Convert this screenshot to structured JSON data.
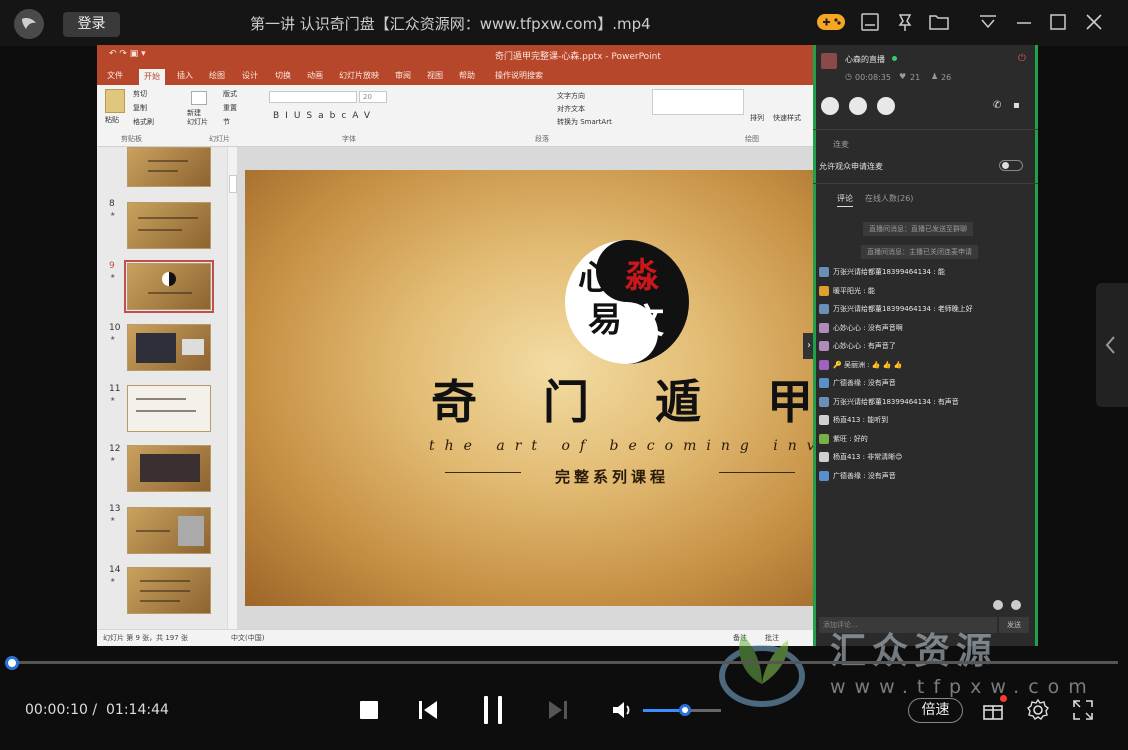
{
  "topbar": {
    "login_label": "登录",
    "title": "第一讲 认识奇门盘【汇众资源网：www.tfpxw.com】.mp4",
    "icons": [
      "game-icon",
      "playlist-icon",
      "pin-icon",
      "folder-icon",
      "menu-icon",
      "minimize-icon",
      "maximize-icon",
      "close-icon"
    ]
  },
  "ppt": {
    "doc_title": "奇门遁甲完整课-心森.pptx - PowerPoint",
    "tabs": [
      "文件",
      "开始",
      "插入",
      "绘图",
      "设计",
      "切换",
      "动画",
      "幻灯片放映",
      "审阅",
      "视图",
      "帮助",
      "操作说明搜索"
    ],
    "active_tab": "开始",
    "ribbon": {
      "paste": "粘贴",
      "cut": "剪切",
      "copy": "复制",
      "format_painter": "格式刷",
      "new_slide": "新建\n幻灯片",
      "layout": "版式",
      "reset": "重置",
      "section": "节",
      "font_size": "20",
      "text_direction": "文字方向",
      "align_text": "对齐文本",
      "smartart": "转换为 SmartArt",
      "arrange": "排列",
      "quick_styles": "快速样式",
      "groups": [
        "剪贴板",
        "幻灯片",
        "字体",
        "段落",
        "绘图"
      ]
    },
    "thumbs": [
      {
        "num": ""
      },
      {
        "num": "8"
      },
      {
        "num": "9",
        "selected": true
      },
      {
        "num": "10"
      },
      {
        "num": "11"
      },
      {
        "num": "12"
      },
      {
        "num": "13"
      },
      {
        "num": "14"
      }
    ],
    "slide": {
      "logo_char_1": "心",
      "logo_char_2": "淼",
      "logo_char_3": "易",
      "logo_char_4": "文",
      "title": "奇门遁甲",
      "subtitle": "the art of becoming invisible",
      "course": "完整系列课程"
    },
    "status": {
      "slide_info": "幻灯片 第 9 张，共 197 张",
      "language": "中文(中国)",
      "notes": "备注",
      "comments": "批注"
    }
  },
  "live": {
    "channel_name": "心森的直播",
    "duration": "00:08:35",
    "likes": "21",
    "viewers": "26",
    "connect_heading": "连麦",
    "allow_connect": "允许观众申请连麦",
    "tab_comments": "评论",
    "tab_online": "在线人数(26)",
    "system_messages": [
      "直播间消息：直播已发送至群聊",
      "直播间消息：主播已关闭连麦申请"
    ],
    "chat": [
      {
        "user": "万张兴请给都董18399464134",
        "text": "能"
      },
      {
        "user": "暖平阳光",
        "text": "能"
      },
      {
        "user": "万张兴请给都董18399464134",
        "text": "老师晚上好"
      },
      {
        "user": "心妙心心",
        "text": "没有声音啊"
      },
      {
        "user": "心妙心心",
        "text": "有声音了"
      },
      {
        "user": "🔑 吴丽洲",
        "text": "👍 👍 👍"
      },
      {
        "user": "广德善缘",
        "text": "没有声音"
      },
      {
        "user": "万张兴请给都董18399464134",
        "text": "有声音"
      },
      {
        "user": "杨直413",
        "text": "能听到"
      },
      {
        "user": "紫旺",
        "text": "好的"
      },
      {
        "user": "杨直413",
        "text": "非常清晰😊"
      },
      {
        "user": "广德善缘",
        "text": "没有声音"
      }
    ],
    "comment_placeholder": "添加评论...",
    "send_label": "发送"
  },
  "watermark": {
    "text": "汇众资源",
    "url": "www.tfpxw.com"
  },
  "player": {
    "current_time": "00:00:10 /",
    "total_time": "01:14:44",
    "progress_fraction": 0.002,
    "volume_fraction": 0.55,
    "speed_label": "倍速",
    "accent": "#3a8dff"
  }
}
